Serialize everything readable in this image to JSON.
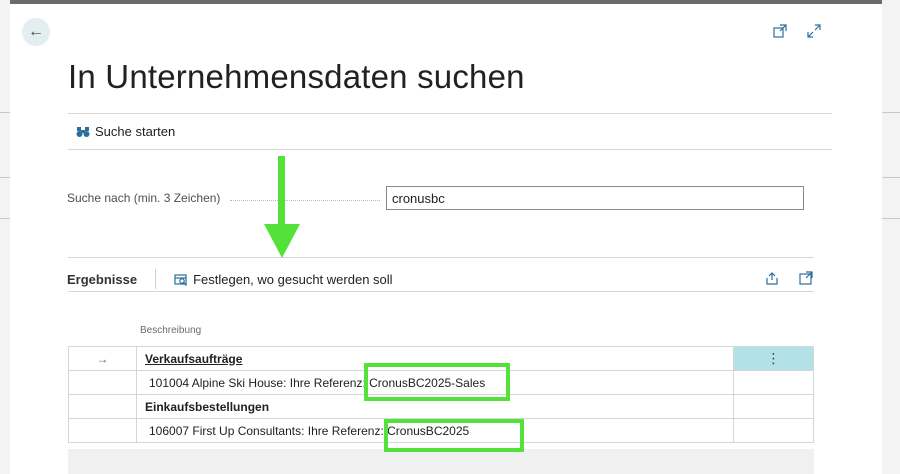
{
  "dialog": {
    "title": "In Unternehmensdaten suchen"
  },
  "toolbar": {
    "start_search_label": "Suche starten"
  },
  "search": {
    "label": "Suche nach (min. 3 Zeichen)",
    "value": "cronusbc"
  },
  "results": {
    "title": "Ergebnisse",
    "define_action_label": "Festlegen, wo gesucht werden soll",
    "column_header": "Beschreibung",
    "rows": [
      {
        "type": "group",
        "text": "Verkaufsaufträge",
        "selected": true,
        "selector": "→",
        "action": "⋮"
      },
      {
        "type": "item",
        "prefix": "101004 Alpine Ski House: Ihre Referen",
        "highlight": "z: CronusBC2025-Sales"
      },
      {
        "type": "group",
        "text": "Einkaufsbestellungen"
      },
      {
        "type": "item",
        "prefix": "106007 First Up Consultants: Ihre Referenz: ",
        "highlight": "CronusBC2025"
      }
    ]
  },
  "colors": {
    "accent_back": "#e3eef0",
    "selected_action": "#b2e1e8",
    "annotation_green": "#54e23a",
    "link_blue": "#2c6d9c"
  },
  "icons": {
    "back": "arrow-left-icon",
    "open_new_window": "open-in-new-window-icon",
    "expand": "expand-icon",
    "binoculars": "binoculars-icon",
    "search_settings": "search-settings-icon",
    "share": "share-icon",
    "open_in_pane": "open-in-pane-icon"
  }
}
